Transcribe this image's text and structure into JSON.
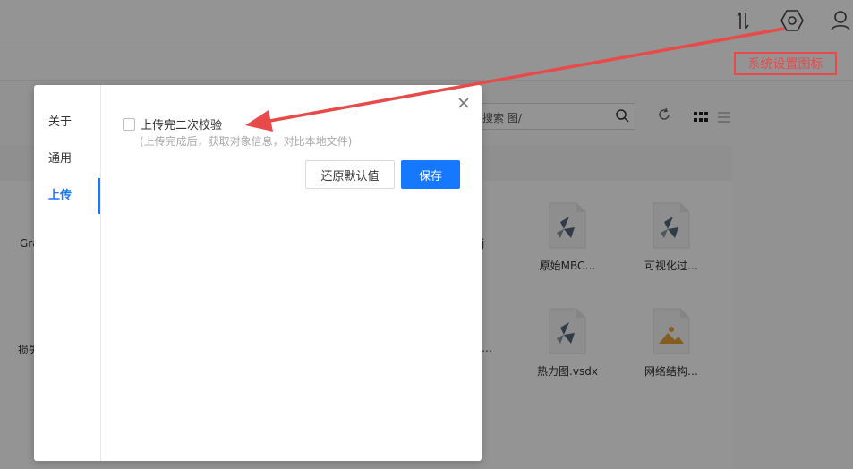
{
  "app": {
    "search_placeholder": "搜索 图/",
    "files": [
      {
        "name": "原始MBC…",
        "type": "visio"
      },
      {
        "name": "可视化过…",
        "type": "visio"
      },
      {
        "name": "热力图.vsdx",
        "type": "visio"
      },
      {
        "name": "网络结构…",
        "type": "image"
      }
    ],
    "partial_labels": [
      "Gra",
      "j",
      "损失",
      "…"
    ]
  },
  "annotation": {
    "label": "系统设置图标",
    "color": "#e84a4a"
  },
  "dialog": {
    "nav": [
      {
        "label": "关于",
        "active": false
      },
      {
        "label": "通用",
        "active": false
      },
      {
        "label": "上传",
        "active": true
      }
    ],
    "checkbox_label": "上传完二次校验",
    "checkbox_checked": false,
    "hint": "(上传完成后，获取对象信息，对比本地文件)",
    "reset_label": "还原默认值",
    "save_label": "保存"
  },
  "colors": {
    "primary": "#1677ff",
    "annotation": "#e84a4a"
  }
}
